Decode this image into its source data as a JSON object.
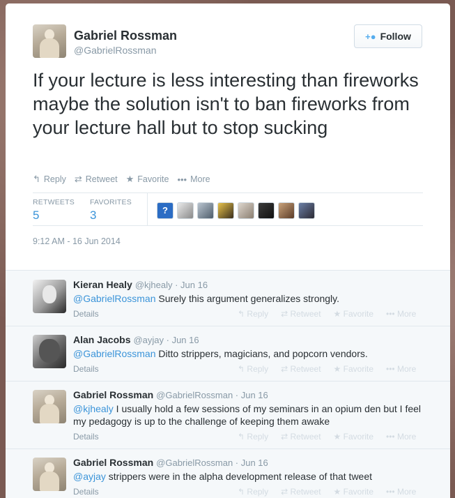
{
  "tweet": {
    "author_name": "Gabriel Rossman",
    "author_handle": "@GabrielRossman",
    "follow_label": "Follow",
    "text": "If your lecture is less interesting than fireworks maybe the solution isn't to ban fireworks from your lecture hall but to stop sucking",
    "actions": {
      "reply": "Reply",
      "retweet": "Retweet",
      "favorite": "Favorite",
      "more": "More"
    },
    "stats": {
      "retweets_label": "RETWEETS",
      "retweets_count": "5",
      "favorites_label": "FAVORITES",
      "favorites_count": "3"
    },
    "timestamp": "9:12 AM - 16 Jun 2014"
  },
  "replies": [
    {
      "name": "Kieran Healy",
      "meta": "@kjhealy · Jun 16",
      "mention": "@GabrielRossman",
      "text": " Surely this argument generalizes strongly.",
      "details": "Details"
    },
    {
      "name": "Alan Jacobs",
      "meta": "@ayjay · Jun 16",
      "mention": "@GabrielRossman",
      "text": " Ditto strippers, magicians, and popcorn vendors.",
      "details": "Details"
    },
    {
      "name": "Gabriel Rossman",
      "meta": "@GabrielRossman · Jun 16",
      "mention": "@kjhealy",
      "text": " I usually hold a few sessions of my seminars in an opium den but I feel my pedagogy is up to the challenge of keeping them awake",
      "details": "Details"
    },
    {
      "name": "Gabriel Rossman",
      "meta": "@GabrielRossman · Jun 16",
      "mention": "@ayjay",
      "text": " strippers were in the alpha development release of that tweet",
      "details": "Details"
    }
  ],
  "reply_actions": {
    "reply": "Reply",
    "retweet": "Retweet",
    "favorite": "Favorite",
    "more": "More"
  },
  "icons": {
    "reply": "reply-arrow-icon",
    "retweet": "retweet-icon",
    "favorite": "star-icon",
    "more": "ellipsis-icon",
    "follow": "add-user-icon"
  },
  "colors": {
    "link": "#3b94d9",
    "text": "#292f33",
    "muted": "#8899a6",
    "follow_icon": "#55acee"
  }
}
